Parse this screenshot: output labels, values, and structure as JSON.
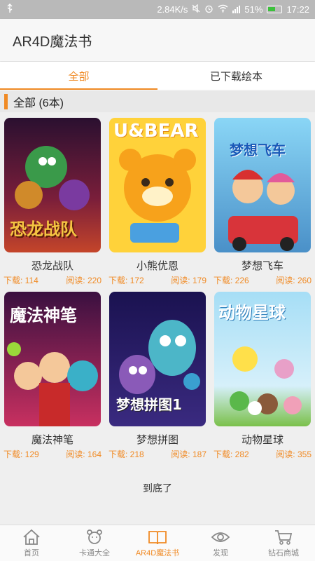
{
  "status_bar": {
    "speed": "2.84K/s",
    "battery_percent": "51%",
    "time": "17:22",
    "icons": [
      "usb-icon",
      "mute-icon",
      "alarm-icon",
      "wifi-icon",
      "signal-icon",
      "battery-icon"
    ]
  },
  "app_bar": {
    "title": "AR4D魔法书"
  },
  "tabs": [
    {
      "label": "全部",
      "active": true
    },
    {
      "label": "已下载绘本",
      "active": false
    }
  ],
  "section": {
    "title": "全部 (6本)"
  },
  "books": [
    {
      "title": "恐龙战队",
      "cover_text": "恐龙战队",
      "downloads": "下载: 114",
      "reads": "阅读: 220",
      "colors": [
        "#5a1a2e",
        "#c43a2a"
      ]
    },
    {
      "title": "小熊优恩",
      "cover_text": "U&BEAR",
      "downloads": "下载: 172",
      "reads": "阅读: 179",
      "colors": [
        "#ffd43b",
        "#f7a21b"
      ]
    },
    {
      "title": "梦想飞车",
      "cover_text": "梦想飞车",
      "downloads": "下载: 226",
      "reads": "阅读: 260",
      "colors": [
        "#6fc8f2",
        "#e4324a"
      ]
    },
    {
      "title": "魔法神笔",
      "cover_text": "魔法神笔",
      "downloads": "下载: 129",
      "reads": "阅读: 164",
      "colors": [
        "#6a1a6a",
        "#d9345a"
      ]
    },
    {
      "title": "梦想拼图",
      "cover_text": "梦想拼图1",
      "downloads": "下载: 218",
      "reads": "阅读: 187",
      "colors": [
        "#2a2070",
        "#4cb6c8"
      ]
    },
    {
      "title": "动物星球",
      "cover_text": "动物星球",
      "downloads": "下载: 282",
      "reads": "阅读: 355",
      "colors": [
        "#8ed0f0",
        "#58a63a"
      ]
    }
  ],
  "end_text": "到底了",
  "bottom_nav": [
    {
      "label": "首页",
      "icon": "home-icon",
      "active": false
    },
    {
      "label": "卡通大全",
      "icon": "bear-icon",
      "active": false
    },
    {
      "label": "AR4D魔法书",
      "icon": "book-icon",
      "active": true
    },
    {
      "label": "发现",
      "icon": "eye-icon",
      "active": false
    },
    {
      "label": "钻石商城",
      "icon": "cart-icon",
      "active": false
    }
  ],
  "colors": {
    "accent": "#f08a24",
    "status_bar": "#b9b9b9"
  }
}
